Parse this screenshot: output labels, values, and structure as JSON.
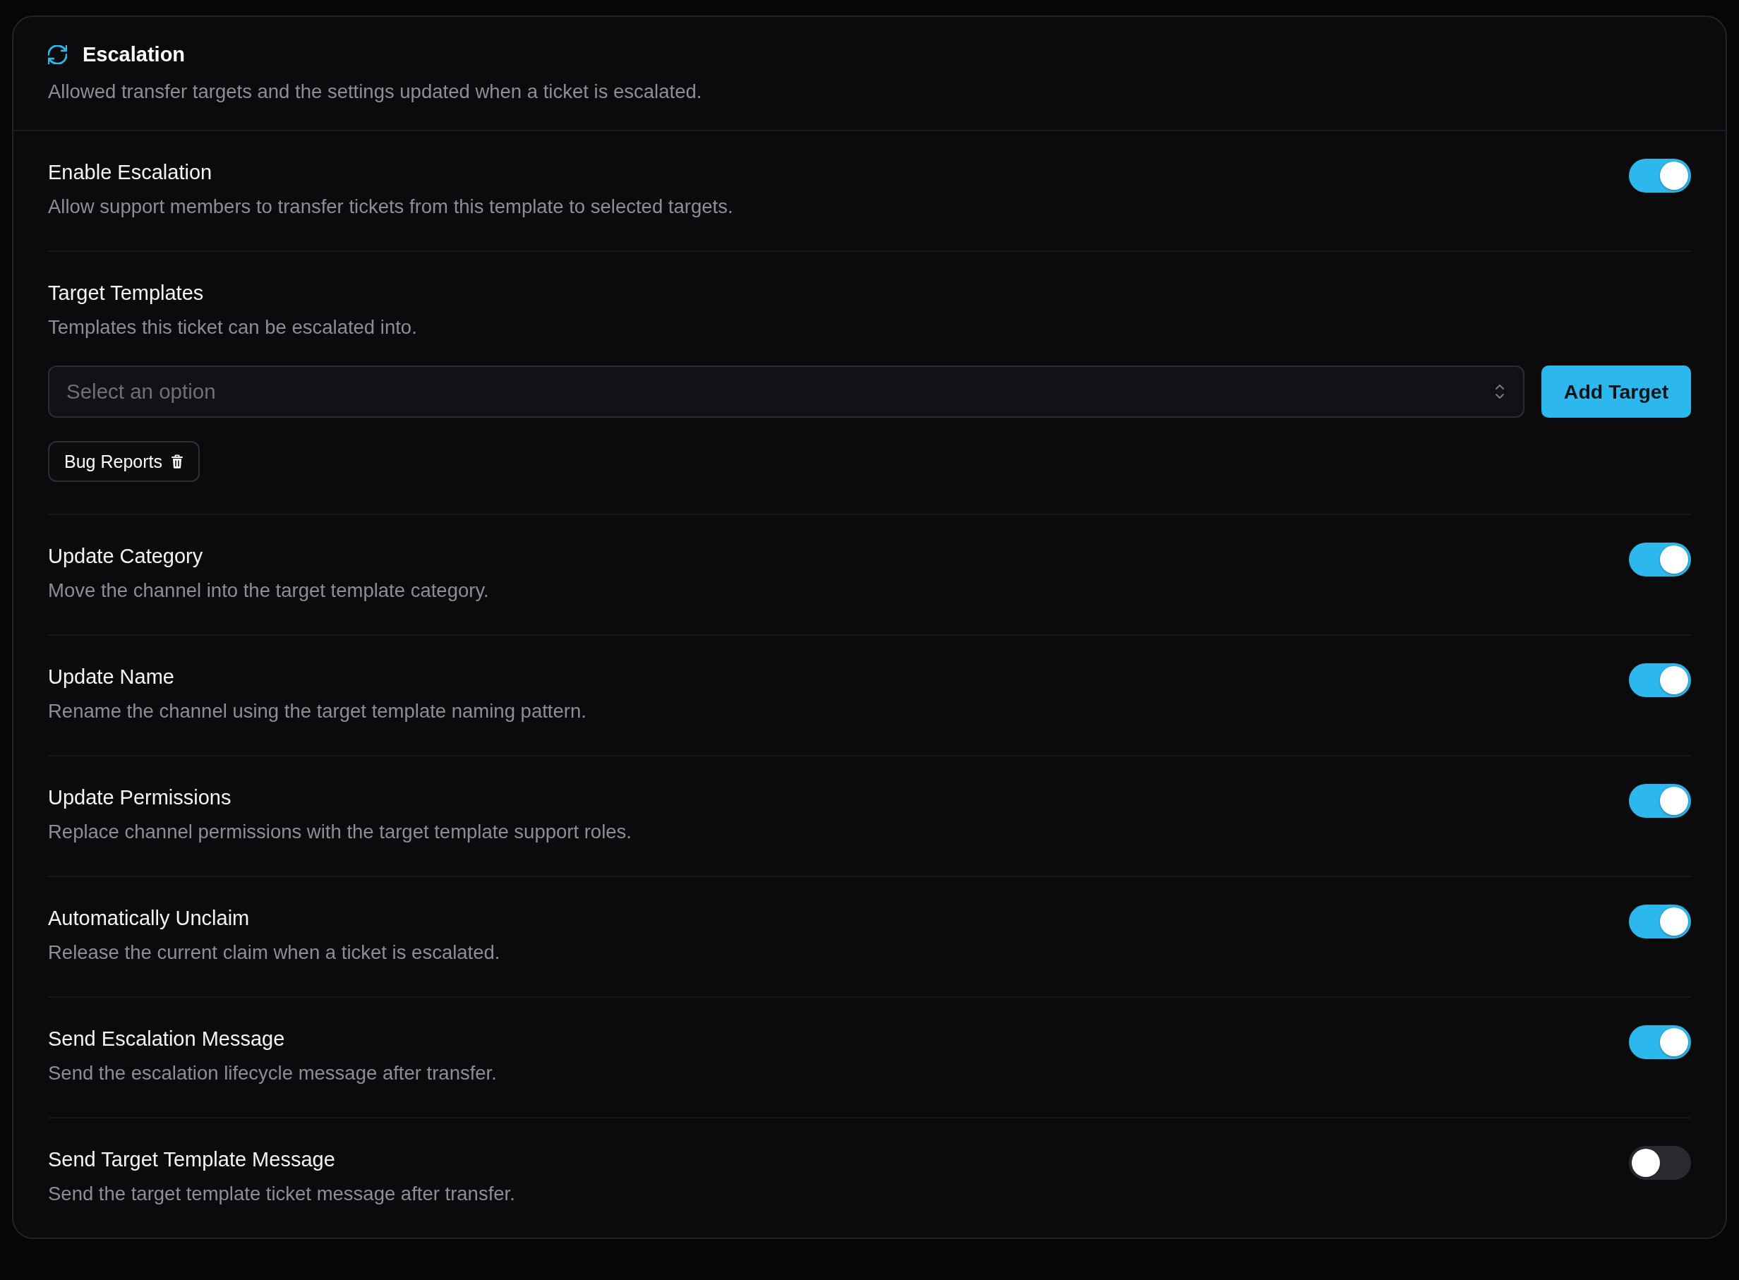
{
  "section": {
    "title": "Escalation",
    "subtitle": "Allowed transfer targets and the settings updated when a ticket is escalated."
  },
  "settings": [
    {
      "kind": "toggle",
      "title": "Enable Escalation",
      "description": "Allow support members to transfer tickets from this template to selected targets.",
      "on": true
    },
    {
      "kind": "picker",
      "title": "Target Templates",
      "description": "Templates this ticket can be escalated into.",
      "select": {
        "placeholder": "Select an option"
      },
      "button": "Add Target",
      "chips": [
        {
          "label": "Bug Reports"
        }
      ]
    },
    {
      "kind": "toggle",
      "title": "Update Category",
      "description": "Move the channel into the target template category.",
      "on": true
    },
    {
      "kind": "toggle",
      "title": "Update Name",
      "description": "Rename the channel using the target template naming pattern.",
      "on": true
    },
    {
      "kind": "toggle",
      "title": "Update Permissions",
      "description": "Replace channel permissions with the target template support roles.",
      "on": true
    },
    {
      "kind": "toggle",
      "title": "Automatically Unclaim",
      "description": "Release the current claim when a ticket is escalated.",
      "on": true
    },
    {
      "kind": "toggle",
      "title": "Send Escalation Message",
      "description": "Send the escalation lifecycle message after transfer.",
      "on": true
    },
    {
      "kind": "toggle",
      "title": "Send Target Template Message",
      "description": "Send the target template ticket message after transfer.",
      "on": false
    }
  ]
}
